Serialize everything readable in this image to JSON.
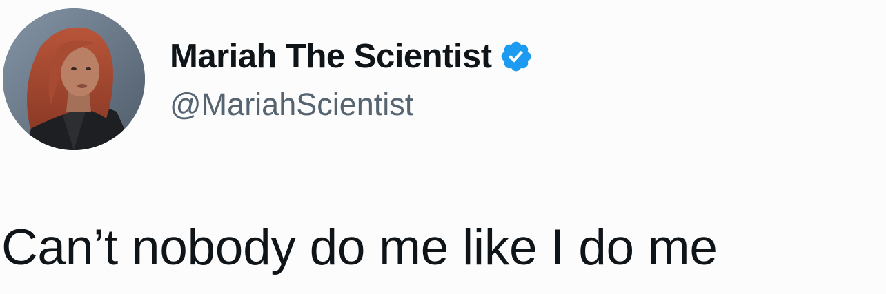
{
  "tweet": {
    "author": {
      "display_name": "Mariah The Scientist",
      "handle": "@MariahScientist",
      "verified": true,
      "verified_icon": "verified-badge-icon",
      "verified_color": "#1d9bf0"
    },
    "text": "Can’t nobody do me like I do me"
  }
}
